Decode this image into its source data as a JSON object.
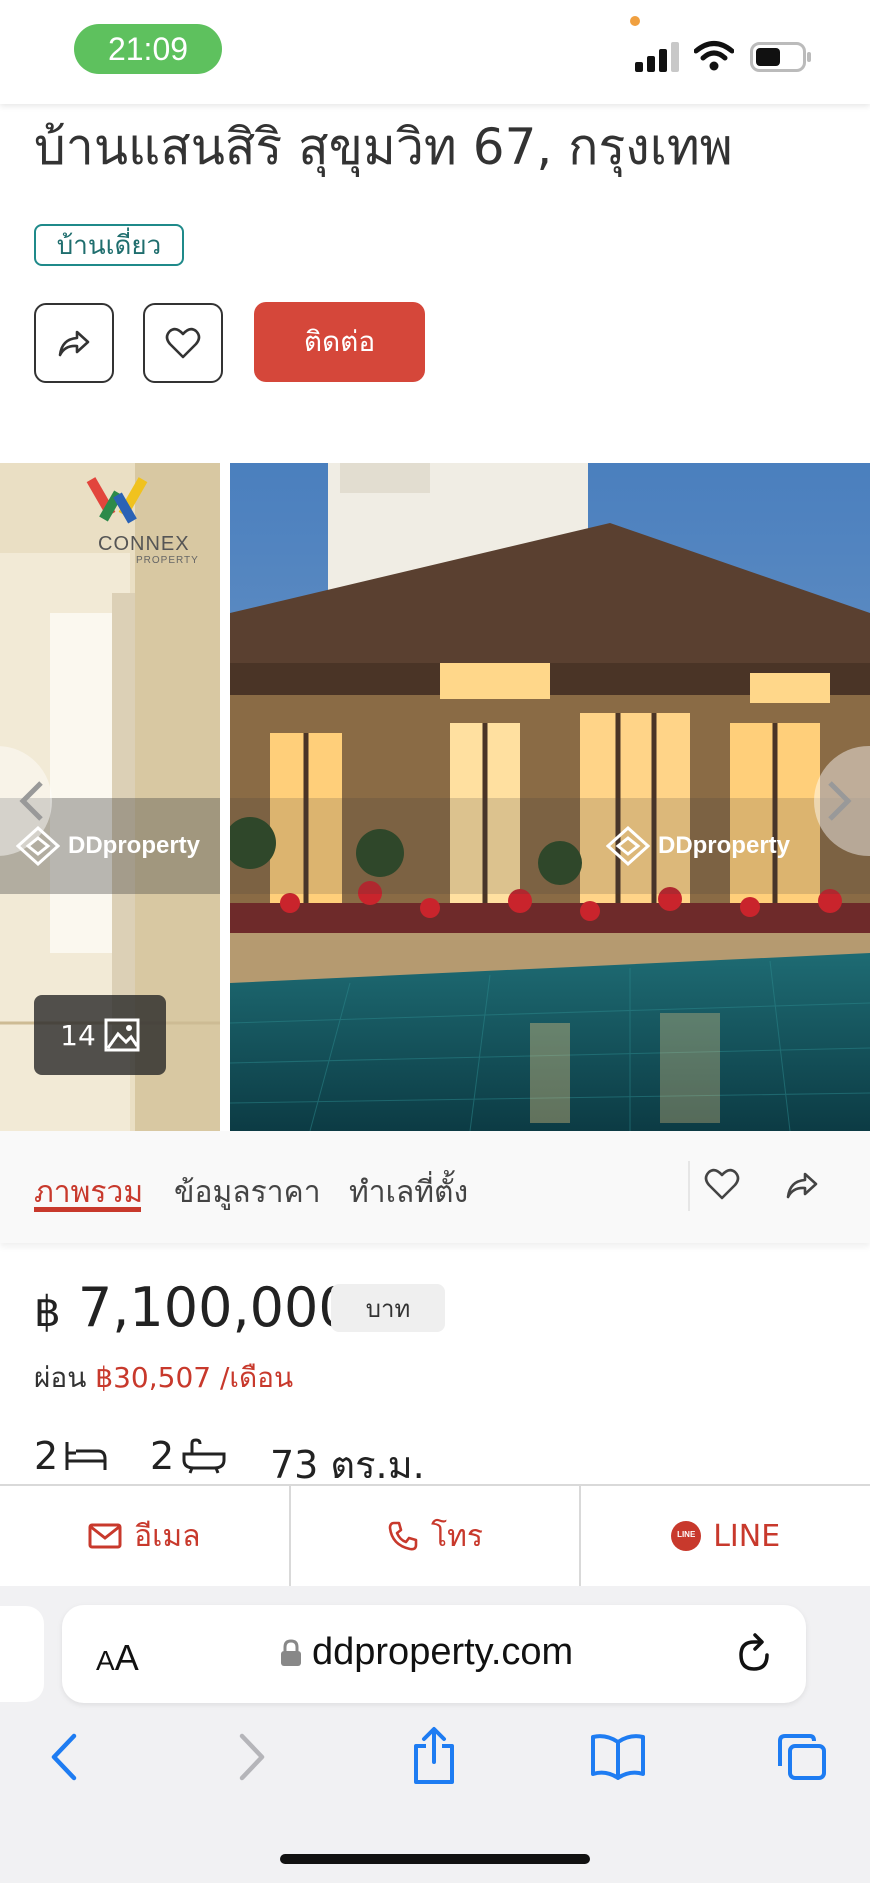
{
  "status_bar": {
    "time": "21:09"
  },
  "listing": {
    "title": "บ้านแสนสิริ สุขุมวิท 67, กรุงเทพ",
    "property_type": "บ้านเดี่ยว",
    "contact_label": "ติดต่อ"
  },
  "gallery": {
    "logo_text": "CONNEX",
    "logo_subtext": "PROPERTY",
    "watermark": "DDproperty",
    "photo_count": "14"
  },
  "tabs": [
    {
      "label": "ภาพรวม",
      "active": true
    },
    {
      "label": "ข้อมูลราคา",
      "active": false
    },
    {
      "label": "ทำเลที่ตั้ง",
      "active": false
    }
  ],
  "price": {
    "currency_symbol": "฿",
    "amount": "7,100,000",
    "unit": "บาท",
    "installment_label": "ผ่อน",
    "installment_value": "฿30,507 /เดือน"
  },
  "specs": {
    "bedrooms": "2",
    "bathrooms": "2",
    "area": "73 ตร.ม."
  },
  "actions": {
    "email": "อีเมล",
    "call": "โทร",
    "line": "LINE",
    "line_badge": "LINE"
  },
  "browser": {
    "text_size_small": "A",
    "text_size_large": "A",
    "domain": "ddproperty.com"
  },
  "colors": {
    "brand_red": "#c8392c",
    "tag_teal": "#1f8a8a",
    "time_pill": "#5ec15e",
    "ios_blue": "#1e7cf2"
  },
  "icons": [
    "share-icon",
    "heart-icon",
    "expand-icon",
    "image-icon",
    "bed-icon",
    "bath-icon",
    "mail-icon",
    "phone-icon",
    "line-icon",
    "lock-icon",
    "reload-icon",
    "back-icon",
    "forward-icon",
    "share-sheet-icon",
    "bookmarks-icon",
    "tabs-icon"
  ]
}
